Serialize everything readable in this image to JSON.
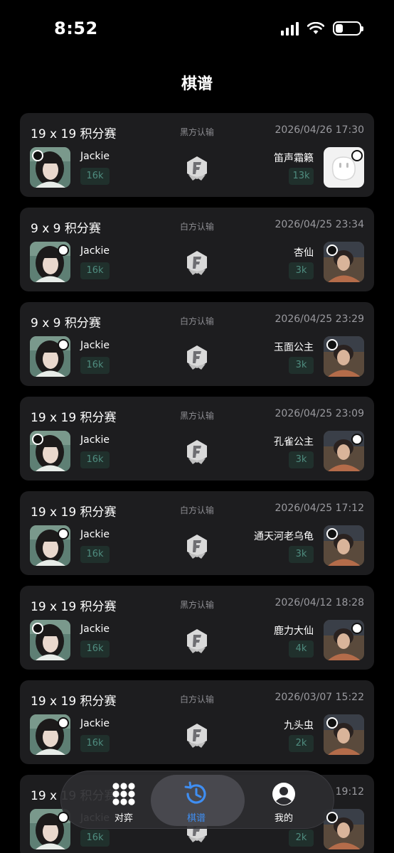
{
  "status_bar": {
    "time": "8:52"
  },
  "page": {
    "title": "棋谱"
  },
  "records": [
    {
      "title": "19 x 19 积分赛",
      "result": "黑方认输",
      "date": "2026/04/26 17:30",
      "left": {
        "name": "Jackie",
        "rank": "16k",
        "stone": "black"
      },
      "right": {
        "name": "笛声霜籁",
        "rank": "13k",
        "stone": "white",
        "avatar": "default-avatar"
      }
    },
    {
      "title": "9 x 9 积分赛",
      "result": "白方认输",
      "date": "2026/04/25 23:34",
      "left": {
        "name": "Jackie",
        "rank": "16k",
        "stone": "white"
      },
      "right": {
        "name": "杏仙",
        "rank": "3k",
        "stone": "black",
        "avatar": "photo-avatar"
      }
    },
    {
      "title": "9 x 9 积分赛",
      "result": "白方认输",
      "date": "2026/04/25 23:29",
      "left": {
        "name": "Jackie",
        "rank": "16k",
        "stone": "white"
      },
      "right": {
        "name": "玉面公主",
        "rank": "3k",
        "stone": "black",
        "avatar": "photo-avatar"
      }
    },
    {
      "title": "19 x 19 积分赛",
      "result": "黑方认输",
      "date": "2026/04/25 23:09",
      "left": {
        "name": "Jackie",
        "rank": "16k",
        "stone": "black"
      },
      "right": {
        "name": "孔雀公主",
        "rank": "3k",
        "stone": "white",
        "avatar": "photo-avatar"
      }
    },
    {
      "title": "19 x 19 积分赛",
      "result": "白方认输",
      "date": "2026/04/25 17:12",
      "left": {
        "name": "Jackie",
        "rank": "16k",
        "stone": "white"
      },
      "right": {
        "name": "通天河老乌龟",
        "rank": "3k",
        "stone": "black",
        "avatar": "photo-avatar"
      }
    },
    {
      "title": "19 x 19 积分赛",
      "result": "黑方认输",
      "date": "2026/04/12 18:28",
      "left": {
        "name": "Jackie",
        "rank": "16k",
        "stone": "black"
      },
      "right": {
        "name": "鹿力大仙",
        "rank": "4k",
        "stone": "white",
        "avatar": "photo-avatar"
      }
    },
    {
      "title": "19 x 19 积分赛",
      "result": "白方认输",
      "date": "2026/03/07 15:22",
      "left": {
        "name": "Jackie",
        "rank": "16k",
        "stone": "white"
      },
      "right": {
        "name": "九头虫",
        "rank": "2k",
        "stone": "black",
        "avatar": "photo-avatar"
      }
    },
    {
      "title": "19 x 19 积分赛",
      "result": "",
      "date": "19:12",
      "left": {
        "name": "Jackie",
        "rank": "16k",
        "stone": "white"
      },
      "right": {
        "name": "",
        "rank": "2k",
        "stone": "black",
        "avatar": "photo-avatar"
      }
    }
  ],
  "nav": [
    {
      "label": "对弈",
      "icon": "grid-icon",
      "active": false
    },
    {
      "label": "棋谱",
      "icon": "history-icon",
      "active": true
    },
    {
      "label": "我的",
      "icon": "person-icon",
      "active": false
    }
  ],
  "colors": {
    "card": "#1d1d1f",
    "rank_bg": "#20302c",
    "rank_text": "#4f8c7f",
    "accent": "#3f8ef2"
  }
}
